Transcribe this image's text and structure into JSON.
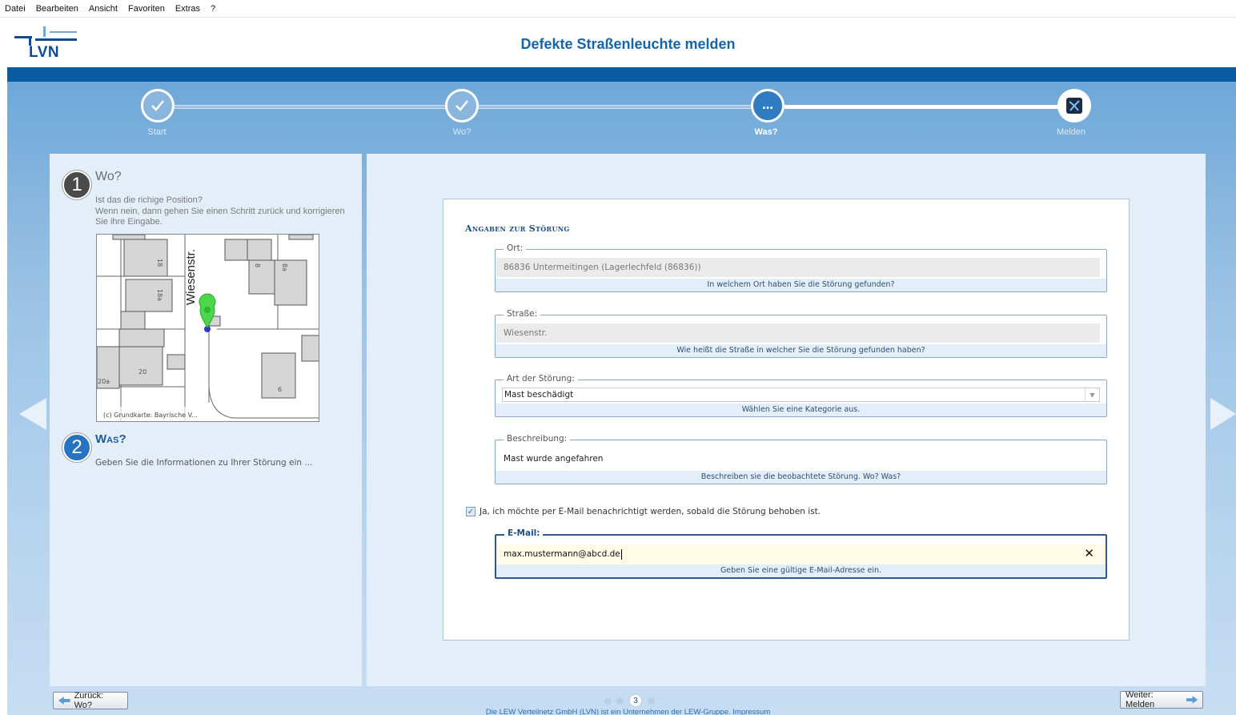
{
  "menu": {
    "items": [
      "Datei",
      "Bearbeiten",
      "Ansicht",
      "Favoriten",
      "Extras",
      "?"
    ]
  },
  "header": {
    "logo_text": "LVN",
    "title": "Defekte Straßenleuchte melden"
  },
  "stepper": {
    "steps": [
      {
        "label": "Start",
        "state": "done",
        "icon": "check-icon"
      },
      {
        "label": "Wo?",
        "state": "done",
        "icon": "check-icon"
      },
      {
        "label": "Was?",
        "state": "active",
        "icon": "ellipsis-icon"
      },
      {
        "label": "Melden",
        "state": "pending",
        "icon": "report-icon"
      }
    ]
  },
  "left": {
    "section1": {
      "number": "1",
      "title": "Wo?",
      "text_line1": "Ist das die richige Position?",
      "text_line2": "Wenn nein, dann gehen Sie einen Schritt zurück und korrigieren",
      "text_line3": "Sie ihre Eingabe."
    },
    "map": {
      "street_label": "Wiesenstr.",
      "house_numbers": [
        "18",
        "18a",
        "8",
        "8a",
        "20",
        "20a",
        "6"
      ],
      "copyright": "(c) Grundkarte: Bayrische V..."
    },
    "section2": {
      "number": "2",
      "title": "Was?",
      "text": "Geben Sie die Informationen zu Ihrer Störung ein ..."
    }
  },
  "form": {
    "heading": "Angaben zur Störung",
    "ort": {
      "legend": "Ort:",
      "value": "86836 Untermeitingen (Lagerlechfeld (86836))",
      "hint": "In welchem Ort haben Sie die Störung gefunden?"
    },
    "strasse": {
      "legend": "Straße:",
      "value": "Wiesenstr.",
      "hint": "Wie heißt die Straße in welcher Sie die Störung gefunden haben?"
    },
    "art": {
      "legend": "Art der Störung:",
      "value": "Mast beschädigt",
      "hint": "Wählen Sie eine Kategorie aus."
    },
    "beschreibung": {
      "legend": "Beschreibung:",
      "value": "Mast wurde angefahren",
      "hint": "Beschreiben sie die beobachtete Störung. Wo? Was?"
    },
    "notify": {
      "label": "Ja, ich möchte per E-Mail benachrichtigt werden, sobald die Störung behoben ist.",
      "checked": true
    },
    "email": {
      "legend": "E-Mail:",
      "value": "max.mustermann@abcd.de",
      "hint": "Geben Sie eine gültige E-Mail-Adresse ein."
    }
  },
  "nav": {
    "back_label": "Zurück: Wo?",
    "next_label": "Weiter: Melden",
    "current_page": "3"
  },
  "footer": {
    "text": "Die LEW Verteilnetz GmbH (LVN) ist ein Unternehmen der LEW-Gruppe. Impressum"
  },
  "colors": {
    "brand_blue": "#0a5aa0",
    "title_blue": "#1565a8",
    "panel_bg": "#e4eef8",
    "marker_green": "#43c843"
  }
}
